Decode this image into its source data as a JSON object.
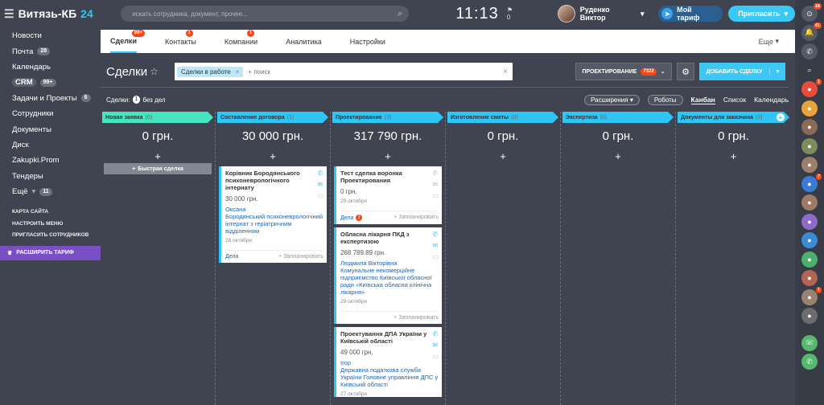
{
  "topbar": {
    "menu_icon": "burger-icon",
    "title": "Витязь-КБ",
    "title_num": "24",
    "search_placeholder": "искать сотрудника, документ, прочее...",
    "time": "11:13",
    "flag_count": "0",
    "user_name": "Руденко Виктор",
    "tariff_label": "Мой тариф",
    "invite_label": "Пригласить"
  },
  "leftnav": {
    "items": [
      {
        "label": "Новости",
        "count": ""
      },
      {
        "label": "Почта",
        "count": "28"
      },
      {
        "label": "Календарь",
        "count": ""
      },
      {
        "label": "CRM",
        "count": "99+"
      },
      {
        "label": "Задачи и Проекты",
        "count": "6"
      },
      {
        "label": "Сотрудники",
        "count": ""
      },
      {
        "label": "Документы",
        "count": ""
      },
      {
        "label": "Диск",
        "count": ""
      },
      {
        "label": "Zakupki.Prom",
        "count": ""
      },
      {
        "label": "Тендеры",
        "count": ""
      },
      {
        "label": "Ещё",
        "count": "11"
      }
    ],
    "links": [
      "КАРТА САЙТА",
      "НАСТРОИТЬ МЕНЮ",
      "ПРИГЛАСИТЬ СОТРУДНИКОВ"
    ],
    "upgrade": "РАСШИРИТЬ ТАРИФ"
  },
  "rightbar": {
    "badges": [
      "18",
      "41",
      "",
      "",
      "1",
      "",
      "",
      "",
      "",
      "7",
      "",
      "",
      "",
      "",
      "",
      "1",
      "",
      "",
      ""
    ]
  },
  "tabs": [
    {
      "label": "Сделки",
      "badge": "99+"
    },
    {
      "label": "Контакты",
      "badge": "1"
    },
    {
      "label": "Компании",
      "badge": "1"
    },
    {
      "label": "Аналитика",
      "badge": ""
    },
    {
      "label": "Настройки",
      "badge": ""
    }
  ],
  "tabs_more": "Еще",
  "toolbar": {
    "title": "Сделки",
    "filter_chip": "Сделки в работе",
    "filter_placeholder": "+ поиск",
    "stage_label": "ПРОЕКТИРОВАНИЕ",
    "stage_count": "7322",
    "add_label": "ДОБАВИТЬ СДЕЛКУ"
  },
  "subbar": {
    "prefix": "Сделки:",
    "count": "1",
    "suffix": "без дел",
    "extensions": "Расширения",
    "robots": "Роботы",
    "views": [
      "Канбан",
      "Список",
      "Календарь"
    ]
  },
  "columns": [
    {
      "name": "Новая заявка",
      "count": "(0)",
      "sum": "0 грн.",
      "color": "#47e4c2",
      "quick": "Быстрая сделка",
      "cards": []
    },
    {
      "name": "Составление договора",
      "count": "(1)",
      "sum": "30 000 грн.",
      "color": "#2fc6f6",
      "cards": [
        {
          "title": "Корівник Бородянського психоневрологічного інтернату",
          "sum": "30 000 грн.",
          "client": "Оксана\nБородянський психоневрологічний інтернат з геріатричним відділенням",
          "date": "28 октября",
          "deals": "Дела",
          "deals_badge": "",
          "plan": "+ Запланировать"
        }
      ]
    },
    {
      "name": "Проектирование",
      "count": "(3)",
      "sum": "317 790 грн.",
      "color": "#2fc6f6",
      "cards": [
        {
          "title": "Тест сделка воронка Проектирования",
          "sum": "0 грн.",
          "client": "",
          "date": "29 октября",
          "deals": "Дела",
          "deals_badge": "1",
          "plan": "+ Запланировать"
        },
        {
          "title": "Обласна лікарня ПКД з експертизою",
          "sum": "268 789.89 грн.",
          "client": "Людмила Вікторівна\nКомунальне некомерційне підприємство Київської обласної ради «Київська обласна клінічна лікарня»",
          "date": "29 октября",
          "deals": "",
          "deals_badge": "",
          "plan": "+ Запланировать"
        },
        {
          "title": "Проектування ДПА України у Київській області",
          "sum": "49 000 грн.",
          "client": "Ігор\nДержавна податкова служба України Головне управління ДПС у Київській області",
          "date": "27 октября",
          "deals": "",
          "deals_badge": "",
          "plan": ""
        }
      ]
    },
    {
      "name": "Изготовление сметы",
      "count": "(0)",
      "sum": "0 грн.",
      "color": "#2fc6f6",
      "cards": []
    },
    {
      "name": "Экспертиза",
      "count": "(0)",
      "sum": "0 грн.",
      "color": "#2fc6f6",
      "cards": []
    },
    {
      "name": "Документы для заказчика",
      "count": "(0)",
      "sum": "0 грн.",
      "color": "#2fc6f6",
      "cards": []
    }
  ]
}
